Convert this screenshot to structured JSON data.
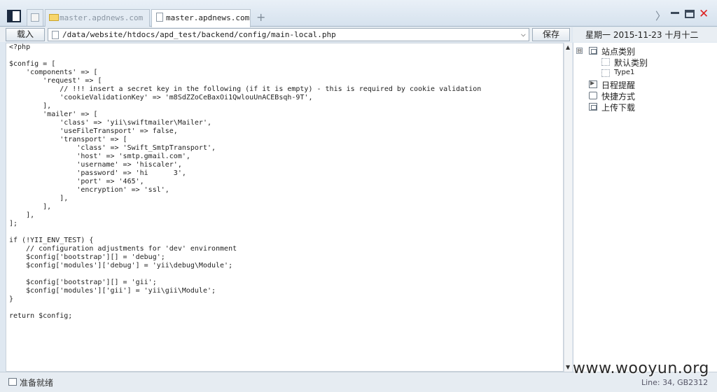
{
  "tabs": {
    "items": [
      {
        "label": "master.apdnews.com",
        "active": false
      },
      {
        "label": "master.apdnews.com",
        "active": true
      }
    ],
    "add_label": "+"
  },
  "window_controls": {
    "chevron_label": "〉",
    "close_label": "✕"
  },
  "toolbar": {
    "load_label": "载入",
    "save_label": "保存",
    "url_value": "/data/website/htdocs/apd_test/backend/config/main-local.php"
  },
  "date_display": "星期一  2015-11-23  十月十二",
  "editor": {
    "lines": [
      "<?php",
      "",
      "$config = [",
      "    'components' => [",
      "        'request' => [",
      "            // !!! insert a secret key in the following (if it is empty) - this is required by cookie validation",
      "            'cookieValidationKey' => 'm8SdZZoCeBaxOi1QwlouUnACEBsqh-9T',",
      "        ],",
      "        'mailer' => [",
      "            'class' => 'yii\\swiftmailer\\Mailer',",
      "            'useFileTransport' => false,",
      "            'transport' => [",
      "                'class' => 'Swift_SmtpTransport',",
      "                'host' => 'smtp.gmail.com',",
      "                'username' => 'hiscaler',",
      "                'password' => 'hi      3',",
      "                'port' => '465',",
      "                'encryption' => 'ssl',",
      "            ],",
      "        ],",
      "    ],",
      "];",
      "",
      "if (!YII_ENV_TEST) {",
      "    // configuration adjustments for 'dev' environment",
      "    $config['bootstrap'][] = 'debug';",
      "    $config['modules']['debug'] = 'yii\\debug\\Module';",
      "",
      "    $config['bootstrap'][] = 'gii';",
      "    $config['modules']['gii'] = 'yii\\gii\\Module';",
      "}",
      "",
      "return $config;"
    ]
  },
  "sidebar": {
    "tree": [
      {
        "label": "站点类别",
        "expander": "⊟"
      },
      {
        "label": "默认类别"
      },
      {
        "label": "Type1"
      },
      {
        "label": "日程提醒"
      },
      {
        "label": "快捷方式"
      },
      {
        "label": "上传下载"
      }
    ]
  },
  "status": {
    "left_text": "准备就绪",
    "right_text": "Line: 34, GB2312"
  },
  "watermark": "www.wooyun.org"
}
